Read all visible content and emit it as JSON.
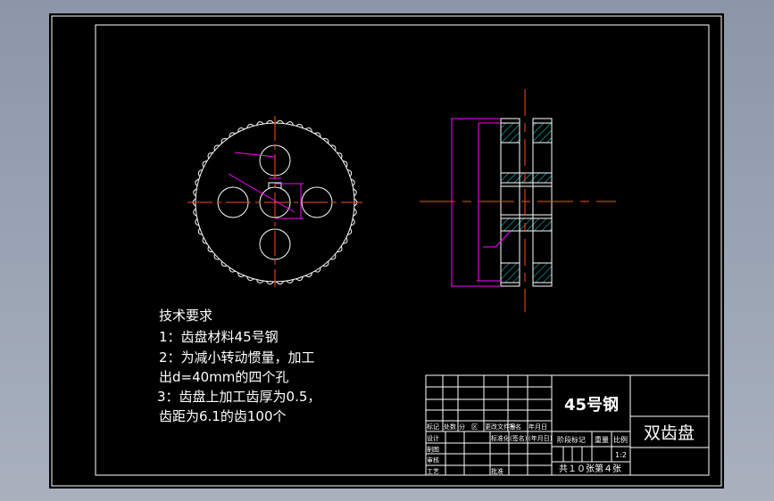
{
  "colors": {
    "background": "#000000",
    "lines": "#ffffff",
    "centerline": "#ff4a1a",
    "dimension": "#ff00ff",
    "hatch": "#00e0e0"
  },
  "tech_requirements": {
    "title": "技术要求",
    "lines": [
      "1：齿盘材料45号钢",
      "2：为减小转动惯量，加工",
      "出d=40mm的四个孔",
      "3：齿盘上加工齿厚为0.5，",
      "齿距为6.1的齿100个"
    ]
  },
  "title_block": {
    "material": "45号钢",
    "part_name": "双齿盘",
    "header_row": [
      "标记",
      "处数",
      "分　区",
      "更改文件号",
      "签名",
      "年月日"
    ],
    "rows": [
      [
        "设计",
        "",
        "",
        "标准化",
        "(签名)",
        "(年月日)"
      ],
      [
        "制图",
        "",
        "",
        "",
        "",
        ""
      ],
      [
        "审核",
        "",
        "",
        "",
        "",
        ""
      ],
      [
        "工艺",
        "",
        "",
        "批准",
        "",
        ""
      ]
    ],
    "stage_label": "阶段标记",
    "weight_label": "重量",
    "scale_label": "比例",
    "scale": "1:2",
    "sheet_info": "共１０张第４张"
  }
}
